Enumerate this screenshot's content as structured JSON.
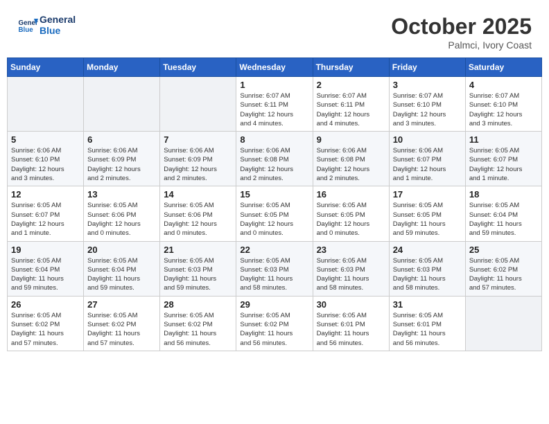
{
  "logo": {
    "line1": "General",
    "line2": "Blue"
  },
  "title": "October 2025",
  "location": "Palmci, Ivory Coast",
  "weekdays": [
    "Sunday",
    "Monday",
    "Tuesday",
    "Wednesday",
    "Thursday",
    "Friday",
    "Saturday"
  ],
  "weeks": [
    [
      {
        "day": "",
        "info": ""
      },
      {
        "day": "",
        "info": ""
      },
      {
        "day": "",
        "info": ""
      },
      {
        "day": "1",
        "info": "Sunrise: 6:07 AM\nSunset: 6:11 PM\nDaylight: 12 hours\nand 4 minutes."
      },
      {
        "day": "2",
        "info": "Sunrise: 6:07 AM\nSunset: 6:11 PM\nDaylight: 12 hours\nand 4 minutes."
      },
      {
        "day": "3",
        "info": "Sunrise: 6:07 AM\nSunset: 6:10 PM\nDaylight: 12 hours\nand 3 minutes."
      },
      {
        "day": "4",
        "info": "Sunrise: 6:07 AM\nSunset: 6:10 PM\nDaylight: 12 hours\nand 3 minutes."
      }
    ],
    [
      {
        "day": "5",
        "info": "Sunrise: 6:06 AM\nSunset: 6:10 PM\nDaylight: 12 hours\nand 3 minutes."
      },
      {
        "day": "6",
        "info": "Sunrise: 6:06 AM\nSunset: 6:09 PM\nDaylight: 12 hours\nand 2 minutes."
      },
      {
        "day": "7",
        "info": "Sunrise: 6:06 AM\nSunset: 6:09 PM\nDaylight: 12 hours\nand 2 minutes."
      },
      {
        "day": "8",
        "info": "Sunrise: 6:06 AM\nSunset: 6:08 PM\nDaylight: 12 hours\nand 2 minutes."
      },
      {
        "day": "9",
        "info": "Sunrise: 6:06 AM\nSunset: 6:08 PM\nDaylight: 12 hours\nand 2 minutes."
      },
      {
        "day": "10",
        "info": "Sunrise: 6:06 AM\nSunset: 6:07 PM\nDaylight: 12 hours\nand 1 minute."
      },
      {
        "day": "11",
        "info": "Sunrise: 6:05 AM\nSunset: 6:07 PM\nDaylight: 12 hours\nand 1 minute."
      }
    ],
    [
      {
        "day": "12",
        "info": "Sunrise: 6:05 AM\nSunset: 6:07 PM\nDaylight: 12 hours\nand 1 minute."
      },
      {
        "day": "13",
        "info": "Sunrise: 6:05 AM\nSunset: 6:06 PM\nDaylight: 12 hours\nand 0 minutes."
      },
      {
        "day": "14",
        "info": "Sunrise: 6:05 AM\nSunset: 6:06 PM\nDaylight: 12 hours\nand 0 minutes."
      },
      {
        "day": "15",
        "info": "Sunrise: 6:05 AM\nSunset: 6:05 PM\nDaylight: 12 hours\nand 0 minutes."
      },
      {
        "day": "16",
        "info": "Sunrise: 6:05 AM\nSunset: 6:05 PM\nDaylight: 12 hours\nand 0 minutes."
      },
      {
        "day": "17",
        "info": "Sunrise: 6:05 AM\nSunset: 6:05 PM\nDaylight: 11 hours\nand 59 minutes."
      },
      {
        "day": "18",
        "info": "Sunrise: 6:05 AM\nSunset: 6:04 PM\nDaylight: 11 hours\nand 59 minutes."
      }
    ],
    [
      {
        "day": "19",
        "info": "Sunrise: 6:05 AM\nSunset: 6:04 PM\nDaylight: 11 hours\nand 59 minutes."
      },
      {
        "day": "20",
        "info": "Sunrise: 6:05 AM\nSunset: 6:04 PM\nDaylight: 11 hours\nand 59 minutes."
      },
      {
        "day": "21",
        "info": "Sunrise: 6:05 AM\nSunset: 6:03 PM\nDaylight: 11 hours\nand 59 minutes."
      },
      {
        "day": "22",
        "info": "Sunrise: 6:05 AM\nSunset: 6:03 PM\nDaylight: 11 hours\nand 58 minutes."
      },
      {
        "day": "23",
        "info": "Sunrise: 6:05 AM\nSunset: 6:03 PM\nDaylight: 11 hours\nand 58 minutes."
      },
      {
        "day": "24",
        "info": "Sunrise: 6:05 AM\nSunset: 6:03 PM\nDaylight: 11 hours\nand 58 minutes."
      },
      {
        "day": "25",
        "info": "Sunrise: 6:05 AM\nSunset: 6:02 PM\nDaylight: 11 hours\nand 57 minutes."
      }
    ],
    [
      {
        "day": "26",
        "info": "Sunrise: 6:05 AM\nSunset: 6:02 PM\nDaylight: 11 hours\nand 57 minutes."
      },
      {
        "day": "27",
        "info": "Sunrise: 6:05 AM\nSunset: 6:02 PM\nDaylight: 11 hours\nand 57 minutes."
      },
      {
        "day": "28",
        "info": "Sunrise: 6:05 AM\nSunset: 6:02 PM\nDaylight: 11 hours\nand 56 minutes."
      },
      {
        "day": "29",
        "info": "Sunrise: 6:05 AM\nSunset: 6:02 PM\nDaylight: 11 hours\nand 56 minutes."
      },
      {
        "day": "30",
        "info": "Sunrise: 6:05 AM\nSunset: 6:01 PM\nDaylight: 11 hours\nand 56 minutes."
      },
      {
        "day": "31",
        "info": "Sunrise: 6:05 AM\nSunset: 6:01 PM\nDaylight: 11 hours\nand 56 minutes."
      },
      {
        "day": "",
        "info": ""
      }
    ]
  ]
}
